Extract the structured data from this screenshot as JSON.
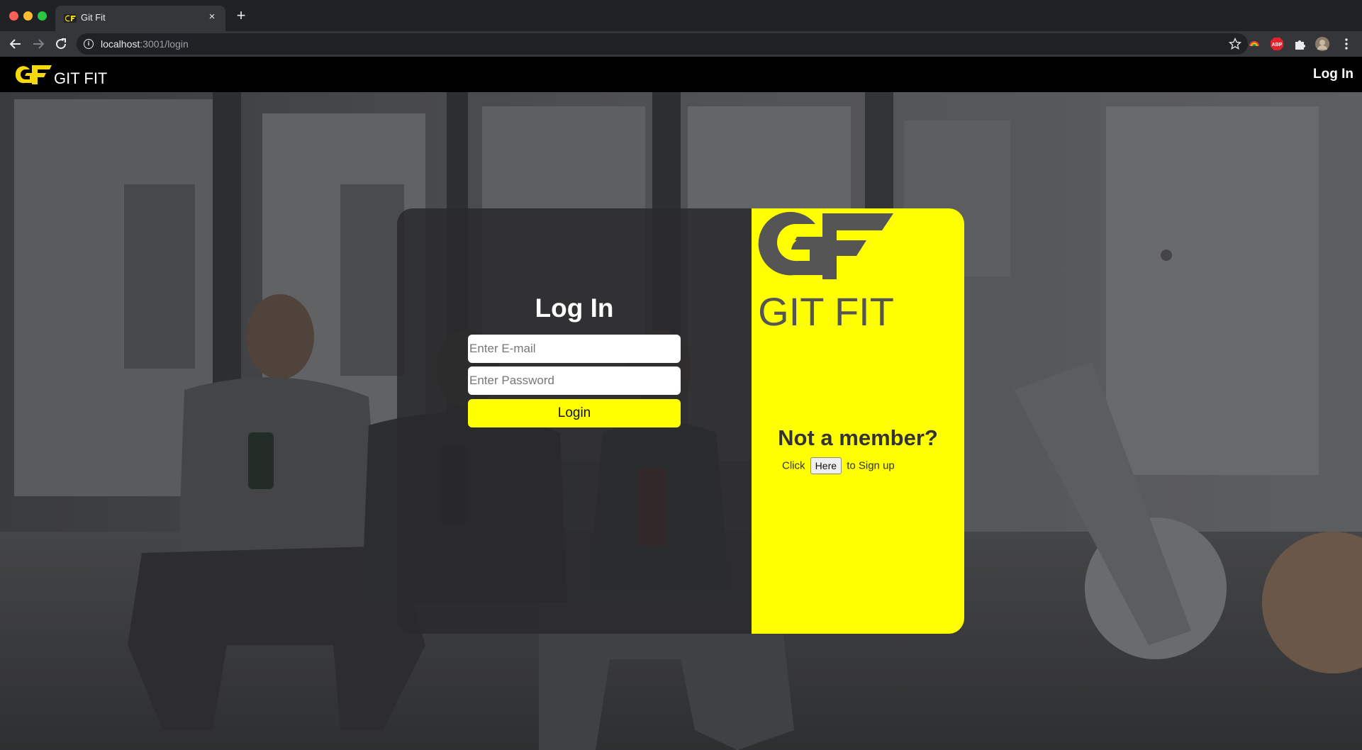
{
  "browser": {
    "tab_title": "Git Fit",
    "new_tab_symbol": "+",
    "close_symbol": "×",
    "url_host": "localhost",
    "url_path": ":3001/login",
    "extensions": [
      "rainbow-icon",
      "adblock-icon",
      "puzzle-icon",
      "profile-avatar"
    ],
    "adblock_label": "ABP"
  },
  "navbar": {
    "logo_text": "GIT FIT",
    "login_link": "Log In"
  },
  "login_form": {
    "title": "Log In",
    "email_placeholder": "Enter E-mail",
    "password_placeholder": "Enter Password",
    "submit_label": "Login"
  },
  "signup_panel": {
    "logo_text": "GIT FIT",
    "heading": "Not a member?",
    "prefix": "Click",
    "button_label": "Here",
    "suffix": "to Sign up"
  },
  "colors": {
    "brand_yellow": "#ffff00",
    "logo_gray": "#555555",
    "navbar": "#000000"
  }
}
